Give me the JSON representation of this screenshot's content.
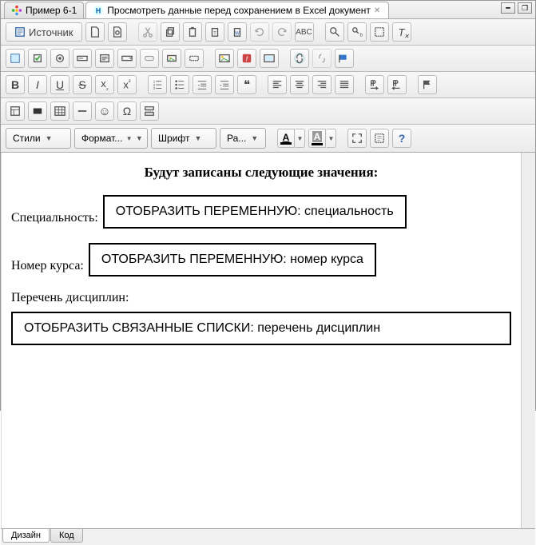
{
  "tabs": {
    "items": [
      {
        "label": "Пример 6-1"
      },
      {
        "label": "Просмотреть данные перед сохранением в Excel документ"
      }
    ]
  },
  "toolbar": {
    "source": "Источник",
    "styles": "Стили",
    "format": "Формат...",
    "font": "Шрифт",
    "size": "Ра...",
    "letter_a": "A",
    "letter_b": "B",
    "letter_i": "I",
    "letter_u": "U",
    "letter_s": "S",
    "sub": "x",
    "sup": "x",
    "quote": "❝",
    "omega": "Ω",
    "smile": "☺",
    "question": "?"
  },
  "document": {
    "heading": "Будут записаны следующие значения:",
    "fields": [
      {
        "label": "Специальность:",
        "box": "ОТОБРАЗИТЬ ПЕРЕМЕННУЮ: специальность"
      },
      {
        "label": "Номер курса:",
        "box": "ОТОБРАЗИТЬ ПЕРЕМЕННУЮ: номер курса"
      },
      {
        "label": "Перечень дисциплин:",
        "box": "ОТОБРАЗИТЬ СВЯЗАННЫЕ СПИСКИ: перечень дисциплин"
      }
    ]
  },
  "bottom": {
    "design": "Дизайн",
    "code": "Код"
  }
}
